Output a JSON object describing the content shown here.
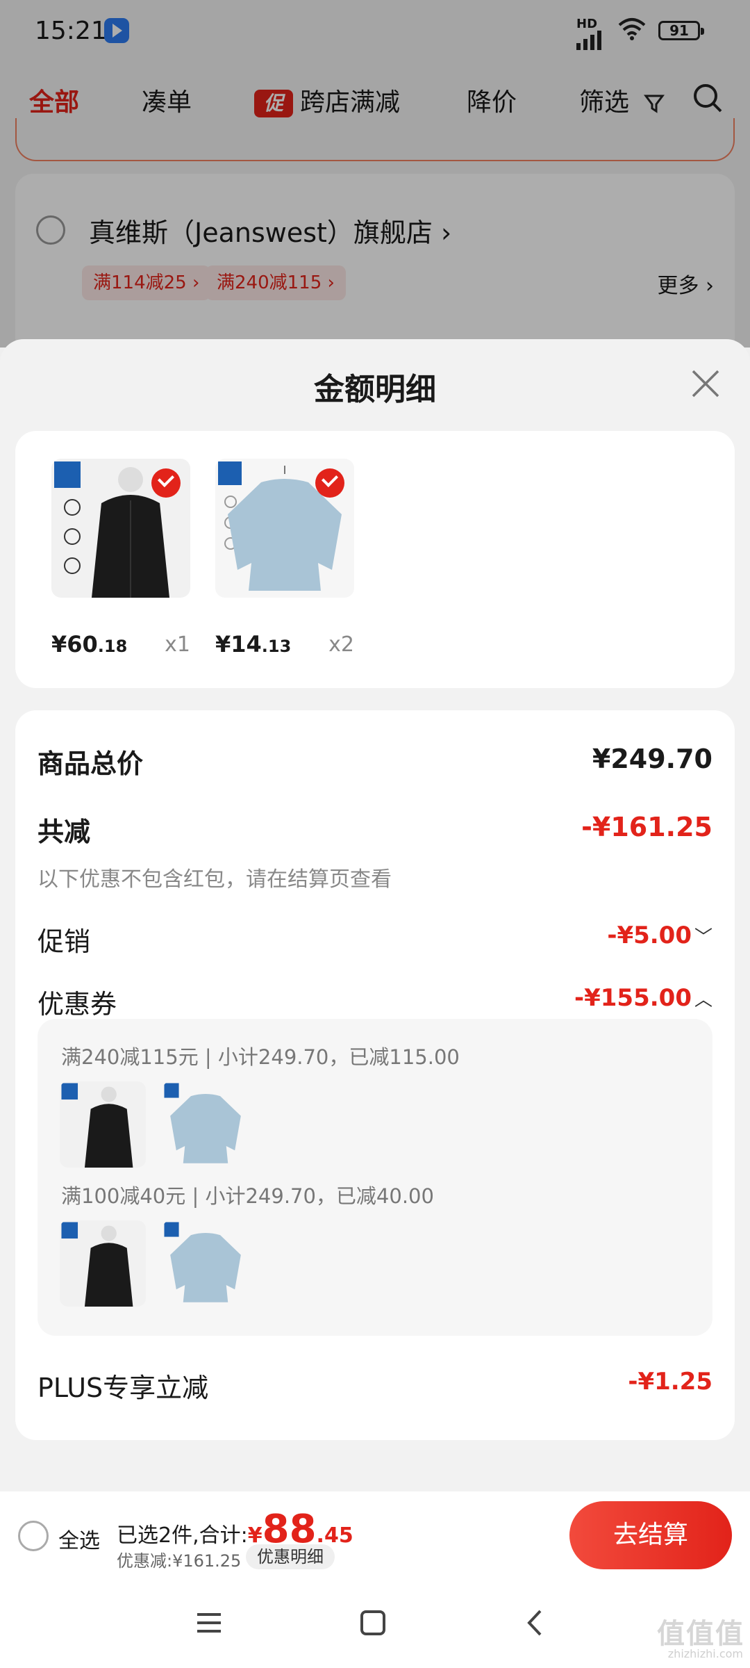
{
  "status_bar": {
    "time": "15:21",
    "network": "HD",
    "battery": "91"
  },
  "tabs": [
    {
      "label": "全部",
      "active": true
    },
    {
      "label": "凑单",
      "active": false
    },
    {
      "label": "跨店满减",
      "badge": "促",
      "active": false
    },
    {
      "label": "降价",
      "active": false
    },
    {
      "label": "筛选",
      "active": false
    }
  ],
  "store": {
    "name": "真维斯（Jeanswest）旗舰店",
    "chips": [
      "满114减25",
      "满240减115"
    ],
    "more": "更多"
  },
  "sheet": {
    "title": "金额明细",
    "products": [
      {
        "price_int": "¥60",
        "price_dec": ".18",
        "qty": "x1",
        "kind": "jacket"
      },
      {
        "price_int": "¥14",
        "price_dec": ".13",
        "qty": "x2",
        "kind": "sweater"
      }
    ],
    "total_label": "商品总价",
    "total_value": "¥249.70",
    "reduce_label": "共减",
    "reduce_value": "-¥161.25",
    "reduce_note": "以下优惠不包含红包，请在结算页查看",
    "promo_label": "促销",
    "promo_value": "-¥5.00",
    "coupon_label": "优惠券",
    "coupon_value": "-¥155.00",
    "coupons": [
      {
        "text": "满240减115元 | 小计249.70，已减115.00"
      },
      {
        "text": "满100减40元 | 小计249.70，已减40.00"
      }
    ],
    "plus_label": "PLUS专享立减",
    "plus_value": "-¥1.25"
  },
  "bottom_bar": {
    "select_all": "全选",
    "summary_prefix": "已选2件,合计:",
    "currency": "¥",
    "total_int": "88",
    "total_dec": ".45",
    "discount_text": "优惠减:¥161.25",
    "discount_detail": "优惠明细",
    "checkout": "去结算"
  },
  "watermark": {
    "text": "值值值",
    "url": "zhizhizhi.com"
  },
  "colors": {
    "accent": "#e2231a",
    "sheet_bg": "#f2f2f2",
    "card_bg": "#ffffff"
  }
}
